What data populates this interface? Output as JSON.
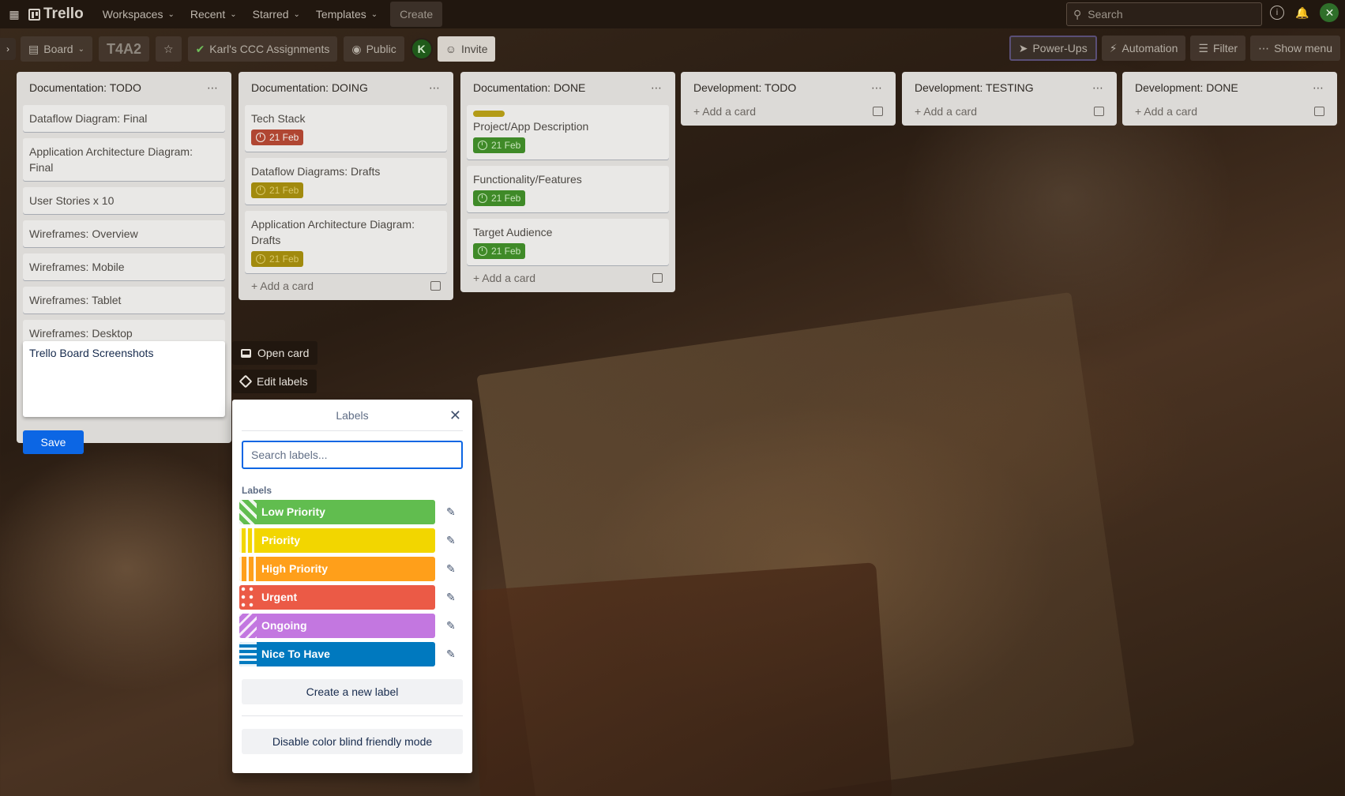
{
  "topnav": {
    "logo": "Trello",
    "menus": [
      "Workspaces",
      "Recent",
      "Starred",
      "Templates"
    ],
    "create": "Create",
    "search_placeholder": "Search"
  },
  "boardbar": {
    "view": "Board",
    "title": "T4A2",
    "workspace": "Karl's CCC Assignments",
    "visibility": "Public",
    "invite": "Invite",
    "powerups": "Power-Ups",
    "automation": "Automation",
    "filter": "Filter",
    "show_menu": "Show menu"
  },
  "lists": [
    {
      "title": "Documentation: TODO",
      "cards": [
        {
          "text": "Dataflow Diagram: Final"
        },
        {
          "text": "Application Architecture Diagram: Final"
        },
        {
          "text": "User Stories x 10"
        },
        {
          "text": "Wireframes: Overview"
        },
        {
          "text": "Wireframes: Mobile"
        },
        {
          "text": "Wireframes: Tablet"
        },
        {
          "text": "Wireframes: Desktop"
        }
      ],
      "add": "Add a card"
    },
    {
      "title": "Documentation: DOING",
      "cards": [
        {
          "text": "Tech Stack",
          "due": "21 Feb",
          "due_color": "red"
        },
        {
          "text": "Dataflow Diagrams: Drafts",
          "due": "21 Feb",
          "due_color": "yellow"
        },
        {
          "text": "Application Architecture Diagram: Drafts",
          "due": "21 Feb",
          "due_color": "yellow"
        }
      ],
      "add": "Add a card"
    },
    {
      "title": "Documentation: DONE",
      "cards": [
        {
          "text": "Project/App Description",
          "due": "21 Feb",
          "due_color": "green",
          "label": true
        },
        {
          "text": "Functionality/Features",
          "due": "21 Feb",
          "due_color": "green"
        },
        {
          "text": "Target Audience",
          "due": "21 Feb",
          "due_color": "green"
        }
      ],
      "add": "Add a card"
    },
    {
      "title": "Development: TODO",
      "cards": [],
      "add": "Add a card"
    },
    {
      "title": "Development: TESTING",
      "cards": [],
      "add": "Add a card"
    },
    {
      "title": "Development: DONE",
      "cards": [],
      "add": "Add a card"
    }
  ],
  "editing": {
    "text": "Trello Board Screenshots",
    "save": "Save",
    "open_card": "Open card",
    "edit_labels": "Edit labels"
  },
  "labels_popover": {
    "title": "Labels",
    "search_placeholder": "Search labels...",
    "section": "Labels",
    "labels": [
      {
        "name": "Low Priority",
        "color": "#4bce97",
        "bg": "#61bd4f"
      },
      {
        "name": "Priority",
        "color": "#f2d600",
        "bg": "#f2d600"
      },
      {
        "name": "High Priority",
        "color": "#ff9f1a",
        "bg": "#ff9f1a"
      },
      {
        "name": "Urgent",
        "color": "#eb5a46",
        "bg": "#eb5a46"
      },
      {
        "name": "Ongoing",
        "color": "#c377e0",
        "bg": "#c377e0"
      },
      {
        "name": "Nice To Have",
        "color": "#0079bf",
        "bg": "#0079bf"
      }
    ],
    "create": "Create a new label",
    "colorblind": "Disable color blind friendly mode"
  }
}
